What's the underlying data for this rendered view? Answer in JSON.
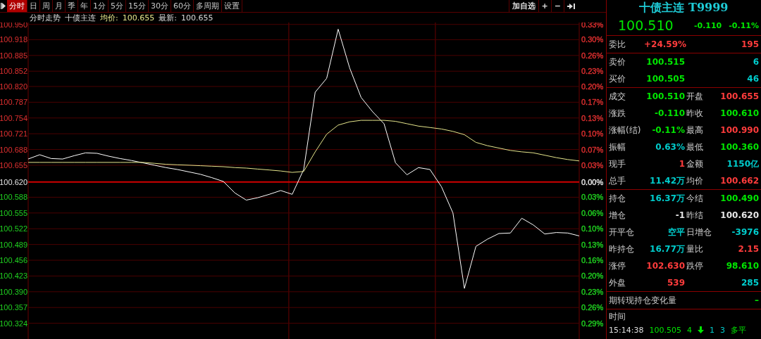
{
  "toolbar": {
    "tabs": [
      {
        "label": "分时",
        "selected": true
      },
      {
        "label": "日",
        "selected": false
      },
      {
        "label": "周",
        "selected": false
      },
      {
        "label": "月",
        "selected": false
      },
      {
        "label": "季",
        "selected": false
      },
      {
        "label": "年",
        "selected": false
      },
      {
        "label": "1分",
        "selected": false
      },
      {
        "label": "5分",
        "selected": false
      },
      {
        "label": "15分",
        "selected": false
      },
      {
        "label": "30分",
        "selected": false
      },
      {
        "label": "60分",
        "selected": false
      },
      {
        "label": "多周期",
        "selected": false
      },
      {
        "label": "设置",
        "selected": false
      }
    ],
    "actions": [
      "加自选",
      "+",
      "−"
    ]
  },
  "info": {
    "title": "分时走势",
    "name": "十债主连",
    "avg_value": "100.655",
    "last_value": "100.655"
  },
  "chart": {
    "percent_ticks": [
      {
        "label": "0.33%",
        "color": "#e03030"
      },
      {
        "label": "0.30%",
        "color": "#e03030"
      },
      {
        "label": "0.26%",
        "color": "#e03030"
      },
      {
        "label": "0.23%",
        "color": "#e03030"
      },
      {
        "label": "0.20%",
        "color": "#e03030"
      },
      {
        "label": "0.17%",
        "color": "#e03030"
      },
      {
        "label": "0.13%",
        "color": "#e03030"
      },
      {
        "label": "0.10%",
        "color": "#e03030"
      },
      {
        "label": "0.07%",
        "color": "#e03030"
      },
      {
        "label": "0.03%",
        "color": "#e03030"
      },
      {
        "label": "0.00%",
        "color": "#e6e6e6"
      },
      {
        "label": "0.03%",
        "color": "#20d020"
      },
      {
        "label": "0.06%",
        "color": "#20d020"
      },
      {
        "label": "0.10%",
        "color": "#20d020"
      },
      {
        "label": "0.13%",
        "color": "#20d020"
      },
      {
        "label": "0.16%",
        "color": "#20d020"
      },
      {
        "label": "0.20%",
        "color": "#20d020"
      },
      {
        "label": "0.23%",
        "color": "#20d020"
      },
      {
        "label": "0.26%",
        "color": "#20d020"
      },
      {
        "label": "0.29%",
        "color": "#20d020"
      }
    ],
    "chart_data": {
      "type": "line",
      "ylim": [
        100.291,
        100.954
      ],
      "yticks": [
        {
          "value": 100.95,
          "label": "100.950"
        },
        {
          "value": 100.918,
          "label": "100.918"
        },
        {
          "value": 100.885,
          "label": "100.885"
        },
        {
          "value": 100.852,
          "label": "100.852"
        },
        {
          "value": 100.82,
          "label": "100.820"
        },
        {
          "value": 100.787,
          "label": "100.787"
        },
        {
          "value": 100.754,
          "label": "100.754"
        },
        {
          "value": 100.721,
          "label": "100.721"
        },
        {
          "value": 100.688,
          "label": "100.688"
        },
        {
          "value": 100.655,
          "label": "100.655"
        },
        {
          "value": 100.62,
          "label": "100.620"
        },
        {
          "value": 100.588,
          "label": "100.588"
        },
        {
          "value": 100.555,
          "label": "100.555"
        },
        {
          "value": 100.522,
          "label": "100.522"
        },
        {
          "value": 100.489,
          "label": "100.489"
        },
        {
          "value": 100.456,
          "label": "100.456"
        },
        {
          "value": 100.423,
          "label": "100.423"
        },
        {
          "value": 100.39,
          "label": "100.390"
        },
        {
          "value": 100.357,
          "label": "100.357"
        },
        {
          "value": 100.324,
          "label": "100.324"
        }
      ],
      "ref_lines": [
        {
          "axis": "y",
          "value": 100.62
        }
      ],
      "grid": true,
      "categories": [
        null,
        null,
        null,
        null,
        null,
        null,
        null,
        null,
        null,
        null,
        null,
        null,
        null,
        null,
        null,
        null,
        null,
        null,
        null,
        null,
        null,
        null,
        null,
        null,
        null,
        null,
        null,
        null,
        null,
        null,
        null,
        null,
        null,
        null,
        null,
        null,
        null,
        null,
        null,
        null,
        null,
        null,
        null,
        null,
        null,
        null,
        null,
        null,
        null
      ],
      "series": [
        {
          "name": "最新:",
          "color": "#ffffff",
          "values": [
            100.668,
            100.677,
            100.669,
            100.668,
            100.675,
            100.681,
            100.68,
            100.674,
            100.669,
            100.665,
            100.66,
            100.655,
            100.65,
            100.646,
            100.641,
            100.636,
            100.629,
            100.621,
            100.597,
            100.582,
            100.587,
            100.594,
            100.602,
            100.594,
            100.646,
            100.808,
            100.837,
            100.94,
            100.859,
            100.797,
            100.767,
            100.742,
            100.66,
            100.635,
            100.65,
            100.646,
            100.61,
            100.555,
            100.397,
            100.485,
            100.5,
            100.512,
            100.513,
            100.544,
            100.53,
            100.511,
            100.514,
            100.513,
            100.507
          ]
        },
        {
          "name": "均价:",
          "color": "#e6e68c",
          "values": [
            100.661,
            100.661,
            100.661,
            100.661,
            100.661,
            100.661,
            100.661,
            100.661,
            100.661,
            100.661,
            100.661,
            100.659,
            100.657,
            100.656,
            100.655,
            100.654,
            100.653,
            100.652,
            100.65,
            100.649,
            100.647,
            100.645,
            100.643,
            100.64,
            100.642,
            100.683,
            100.72,
            100.739,
            100.746,
            100.749,
            100.749,
            100.749,
            100.747,
            100.742,
            100.737,
            100.734,
            100.731,
            100.726,
            100.719,
            100.703,
            100.696,
            100.691,
            100.686,
            100.683,
            100.681,
            100.676,
            100.671,
            100.667,
            100.664
          ]
        }
      ]
    }
  },
  "quote": {
    "title": "十债主连 T9999",
    "price": "100.510",
    "change": "-0.110",
    "change_pct": "-0.11%",
    "sections": [
      [
        {
          "label": "委比",
          "value": {
            "text": "+24.59%",
            "color": "#ff3c3c"
          },
          "value2": {
            "text": "195",
            "color": "#ff3c3c"
          }
        }
      ],
      [
        {
          "label": "卖价",
          "value": {
            "text": "100.515",
            "color": "#00e600"
          },
          "value2": {
            "text": "6",
            "color": "#00cccc"
          }
        },
        {
          "label": "买价",
          "value": {
            "text": "100.505",
            "color": "#00e600"
          },
          "value2": {
            "text": "46",
            "color": "#00cccc"
          }
        }
      ],
      [
        {
          "label": "成交",
          "value": {
            "text": "100.510",
            "color": "#00e600"
          },
          "label2": "开盘",
          "value2": {
            "text": "100.655",
            "color": "#ff3c3c"
          }
        },
        {
          "label": "涨跌",
          "value": {
            "text": "-0.110",
            "color": "#00e600"
          },
          "label2": "昨收",
          "value2": {
            "text": "100.610",
            "color": "#00e600"
          }
        },
        {
          "label": "涨幅(结)",
          "value": {
            "text": "-0.11%",
            "color": "#00e600"
          },
          "label2": "最高",
          "value2": {
            "text": "100.990",
            "color": "#ff3c3c"
          }
        },
        {
          "label": "振幅",
          "value": {
            "text": "0.63%",
            "color": "#00cccc"
          },
          "label2": "最低",
          "value2": {
            "text": "100.360",
            "color": "#00e600"
          }
        },
        {
          "label": "现手",
          "value": {
            "text": "1",
            "color": "#ff3c3c"
          },
          "label2": "金额",
          "value2": {
            "text": "1150亿",
            "color": "#00cccc"
          }
        },
        {
          "label": "总手",
          "value": {
            "text": "11.42万",
            "color": "#00cccc"
          },
          "label2": "均价",
          "value2": {
            "text": "100.662",
            "color": "#ff3c3c"
          }
        }
      ],
      [
        {
          "label": "持仓",
          "value": {
            "text": "16.37万",
            "color": "#00cccc"
          },
          "label2": "今结",
          "value2": {
            "text": "100.490",
            "color": "#00e600"
          }
        },
        {
          "label": "增仓",
          "value": {
            "text": "-1",
            "color": "#e6e6e6"
          },
          "label2": "昨结",
          "value2": {
            "text": "100.620",
            "color": "#e6e6e6"
          }
        },
        {
          "label": "开平仓",
          "value": {
            "text": "空平",
            "color": "#00cccc"
          },
          "label2": "日增仓",
          "value2": {
            "text": "-3976",
            "color": "#00cccc"
          }
        },
        {
          "label": "昨持仓",
          "value": {
            "text": "16.77万",
            "color": "#00cccc"
          },
          "label2": "量比",
          "value2": {
            "text": "2.15",
            "color": "#ff3c3c"
          }
        },
        {
          "label": "涨停",
          "value": {
            "text": "102.630",
            "color": "#ff3c3c"
          },
          "label2": "跌停",
          "value2": {
            "text": "98.610",
            "color": "#00e600"
          }
        },
        {
          "label": "外盘",
          "value": {
            "text": "539",
            "color": "#ff3c3c"
          },
          "value2": {
            "text": "285",
            "color": "#00cccc"
          }
        }
      ],
      [
        {
          "label": "期转现持仓变化量",
          "value2": {
            "text": "–",
            "color": "#00e600"
          }
        }
      ]
    ],
    "ticks_header": "时间",
    "ticks": [
      {
        "time": "15:14:38",
        "price": "100.505",
        "volume": "4",
        "falling": true,
        "open": "1",
        "close": "3",
        "kind": "多平"
      }
    ]
  }
}
